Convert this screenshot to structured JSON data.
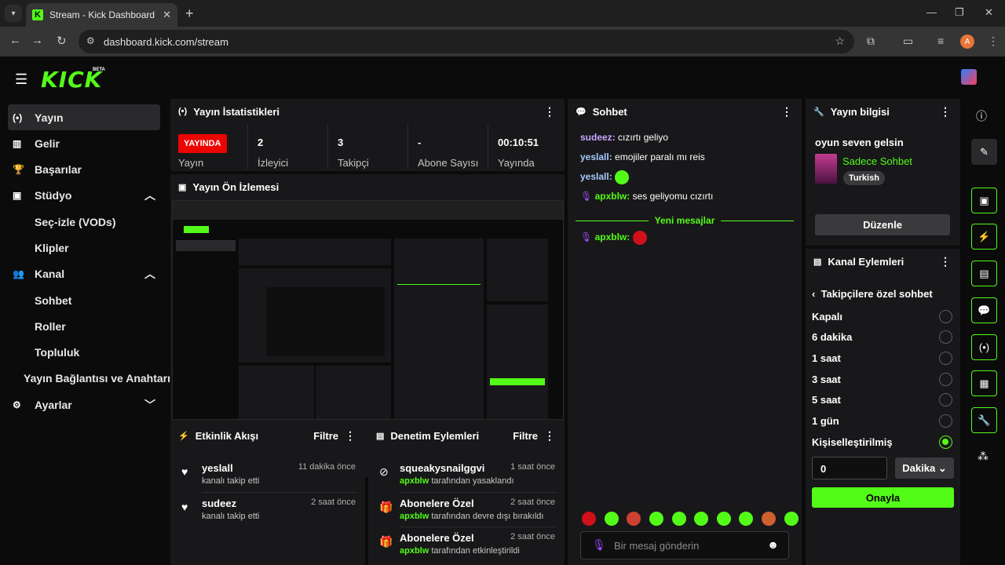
{
  "browser": {
    "tab_title": "Stream - Kick Dashboard",
    "url": "dashboard.kick.com/stream",
    "profile_initial": "A"
  },
  "app": {
    "logo": "KICK",
    "beta": "BETA"
  },
  "sidebar": {
    "items": [
      {
        "label": "Yayın",
        "icon": "broadcast-icon",
        "active": true
      },
      {
        "label": "Gelir",
        "icon": "chart-icon"
      },
      {
        "label": "Başarılar",
        "icon": "trophy-icon"
      },
      {
        "label": "Stüdyo",
        "icon": "studio-icon",
        "expanded": true
      },
      {
        "label": "Seç-izle (VODs)",
        "sub": true
      },
      {
        "label": "Klipler",
        "sub": true
      },
      {
        "label": "Kanal",
        "icon": "channel-icon",
        "expanded": true
      },
      {
        "label": "Sohbet",
        "sub": true
      },
      {
        "label": "Roller",
        "sub": true
      },
      {
        "label": "Topluluk",
        "sub": true
      },
      {
        "label": "Yayın Bağlantısı ve Anahtarı",
        "sub": true
      },
      {
        "label": "Ayarlar",
        "icon": "gear-icon",
        "expanded": false
      }
    ]
  },
  "stats": {
    "title": "Yayın İstatistikleri",
    "live_badge": "YAYINDA",
    "live_label": "Yayın",
    "cells": [
      {
        "value": "2",
        "label": "İzleyici"
      },
      {
        "value": "3",
        "label": "Takipçi"
      },
      {
        "value": "-",
        "label": "Abone Sayısı"
      },
      {
        "value": "00:10:51",
        "label": "Yayında"
      }
    ]
  },
  "preview": {
    "title": "Yayın Ön İzlemesi"
  },
  "activity": {
    "title": "Etkinlik Akışı",
    "filter": "Filtre",
    "items": [
      {
        "name": "yeslall",
        "desc": "kanalı takip etti",
        "time": "11 dakika önce"
      },
      {
        "name": "sudeez",
        "desc": "kanalı takip etti",
        "time": "2 saat önce"
      }
    ]
  },
  "moderation": {
    "title": "Denetim Eylemleri",
    "filter": "Filtre",
    "items": [
      {
        "name": "squeakysnailggvi",
        "actor": "apxblw",
        "desc": " tarafından yasaklandı",
        "time": "1 saat önce"
      },
      {
        "name": "Abonelere Özel",
        "actor": "apxblw",
        "desc": " tarafından devre dışı bırakıldı",
        "time": "2 saat önce"
      },
      {
        "name": "Abonelere Özel",
        "actor": "apxblw",
        "desc": " tarafından etkinleştirildi",
        "time": "2 saat önce"
      }
    ]
  },
  "chat": {
    "title": "Sohbet",
    "messages": [
      {
        "user": "sudeez",
        "color": "#c7a6ff",
        "text": " cızırtı geliyo"
      },
      {
        "user": "yeslall",
        "color": "#a8c8ff",
        "text": " emojiler paralı mı reis"
      },
      {
        "user": "yeslall",
        "color": "#a8c8ff",
        "text": ""
      },
      {
        "user": "apxblw",
        "color": "#53fc18",
        "text": " ses geliyomu cızırtı"
      }
    ],
    "new_messages": "Yeni mesajlar",
    "last_user": "apxblw:",
    "placeholder": "Bir mesaj gönderin"
  },
  "info": {
    "title": "Yayın bilgisi",
    "stream_title": "oyun seven gelsin",
    "category": "Sadece Sohbet",
    "language": "Turkish",
    "edit": "Düzenle"
  },
  "channel_actions": {
    "title": "Kanal Eylemleri",
    "subtitle": "Takipçilere özel sohbet",
    "options": [
      "Kapalı",
      "6 dakika",
      "1 saat",
      "3 saat",
      "5 saat",
      "1 gün",
      "Kişiselleştirilmiş"
    ],
    "selected": 6,
    "custom_value": "0",
    "unit": "Dakika",
    "confirm": "Onayla"
  },
  "colors": {
    "accent": "#53fc18",
    "live": "#eb0400",
    "panel": "#18181a"
  }
}
